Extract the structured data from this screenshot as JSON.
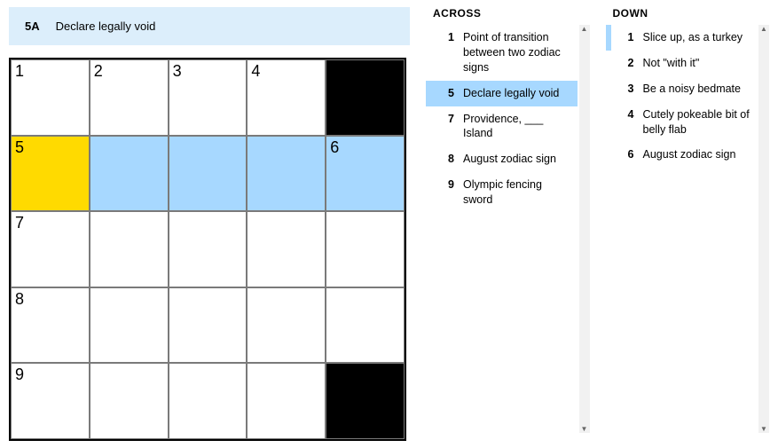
{
  "cluebar": {
    "label": "5A",
    "text": "Declare legally void"
  },
  "grid": {
    "cols": 5,
    "rows": 5,
    "cells": [
      {
        "num": "1"
      },
      {
        "num": "2"
      },
      {
        "num": "3"
      },
      {
        "num": "4"
      },
      {
        "block": true
      },
      {
        "num": "5",
        "focus": true
      },
      {
        "hl": true
      },
      {
        "hl": true
      },
      {
        "hl": true
      },
      {
        "num": "6",
        "hl": true
      },
      {
        "num": "7"
      },
      {},
      {},
      {},
      {},
      {
        "num": "8"
      },
      {},
      {},
      {},
      {},
      {
        "num": "9"
      },
      {},
      {},
      {},
      {
        "block": true
      }
    ]
  },
  "across": {
    "title": "ACROSS",
    "items": [
      {
        "n": "1",
        "t": "Point of transition between two zodiac signs"
      },
      {
        "n": "5",
        "t": "Declare legally void",
        "active": true
      },
      {
        "n": "7",
        "t": "Providence, ___ Island"
      },
      {
        "n": "8",
        "t": "August zodiac sign"
      },
      {
        "n": "9",
        "t": "Olympic fencing sword"
      }
    ]
  },
  "down": {
    "title": "DOWN",
    "items": [
      {
        "n": "1",
        "t": "Slice up, as a turkey",
        "related": true
      },
      {
        "n": "2",
        "t": "Not \"with it\""
      },
      {
        "n": "3",
        "t": "Be a noisy bedmate"
      },
      {
        "n": "4",
        "t": "Cutely pokeable bit of belly flab"
      },
      {
        "n": "6",
        "t": "August zodiac sign"
      }
    ]
  }
}
